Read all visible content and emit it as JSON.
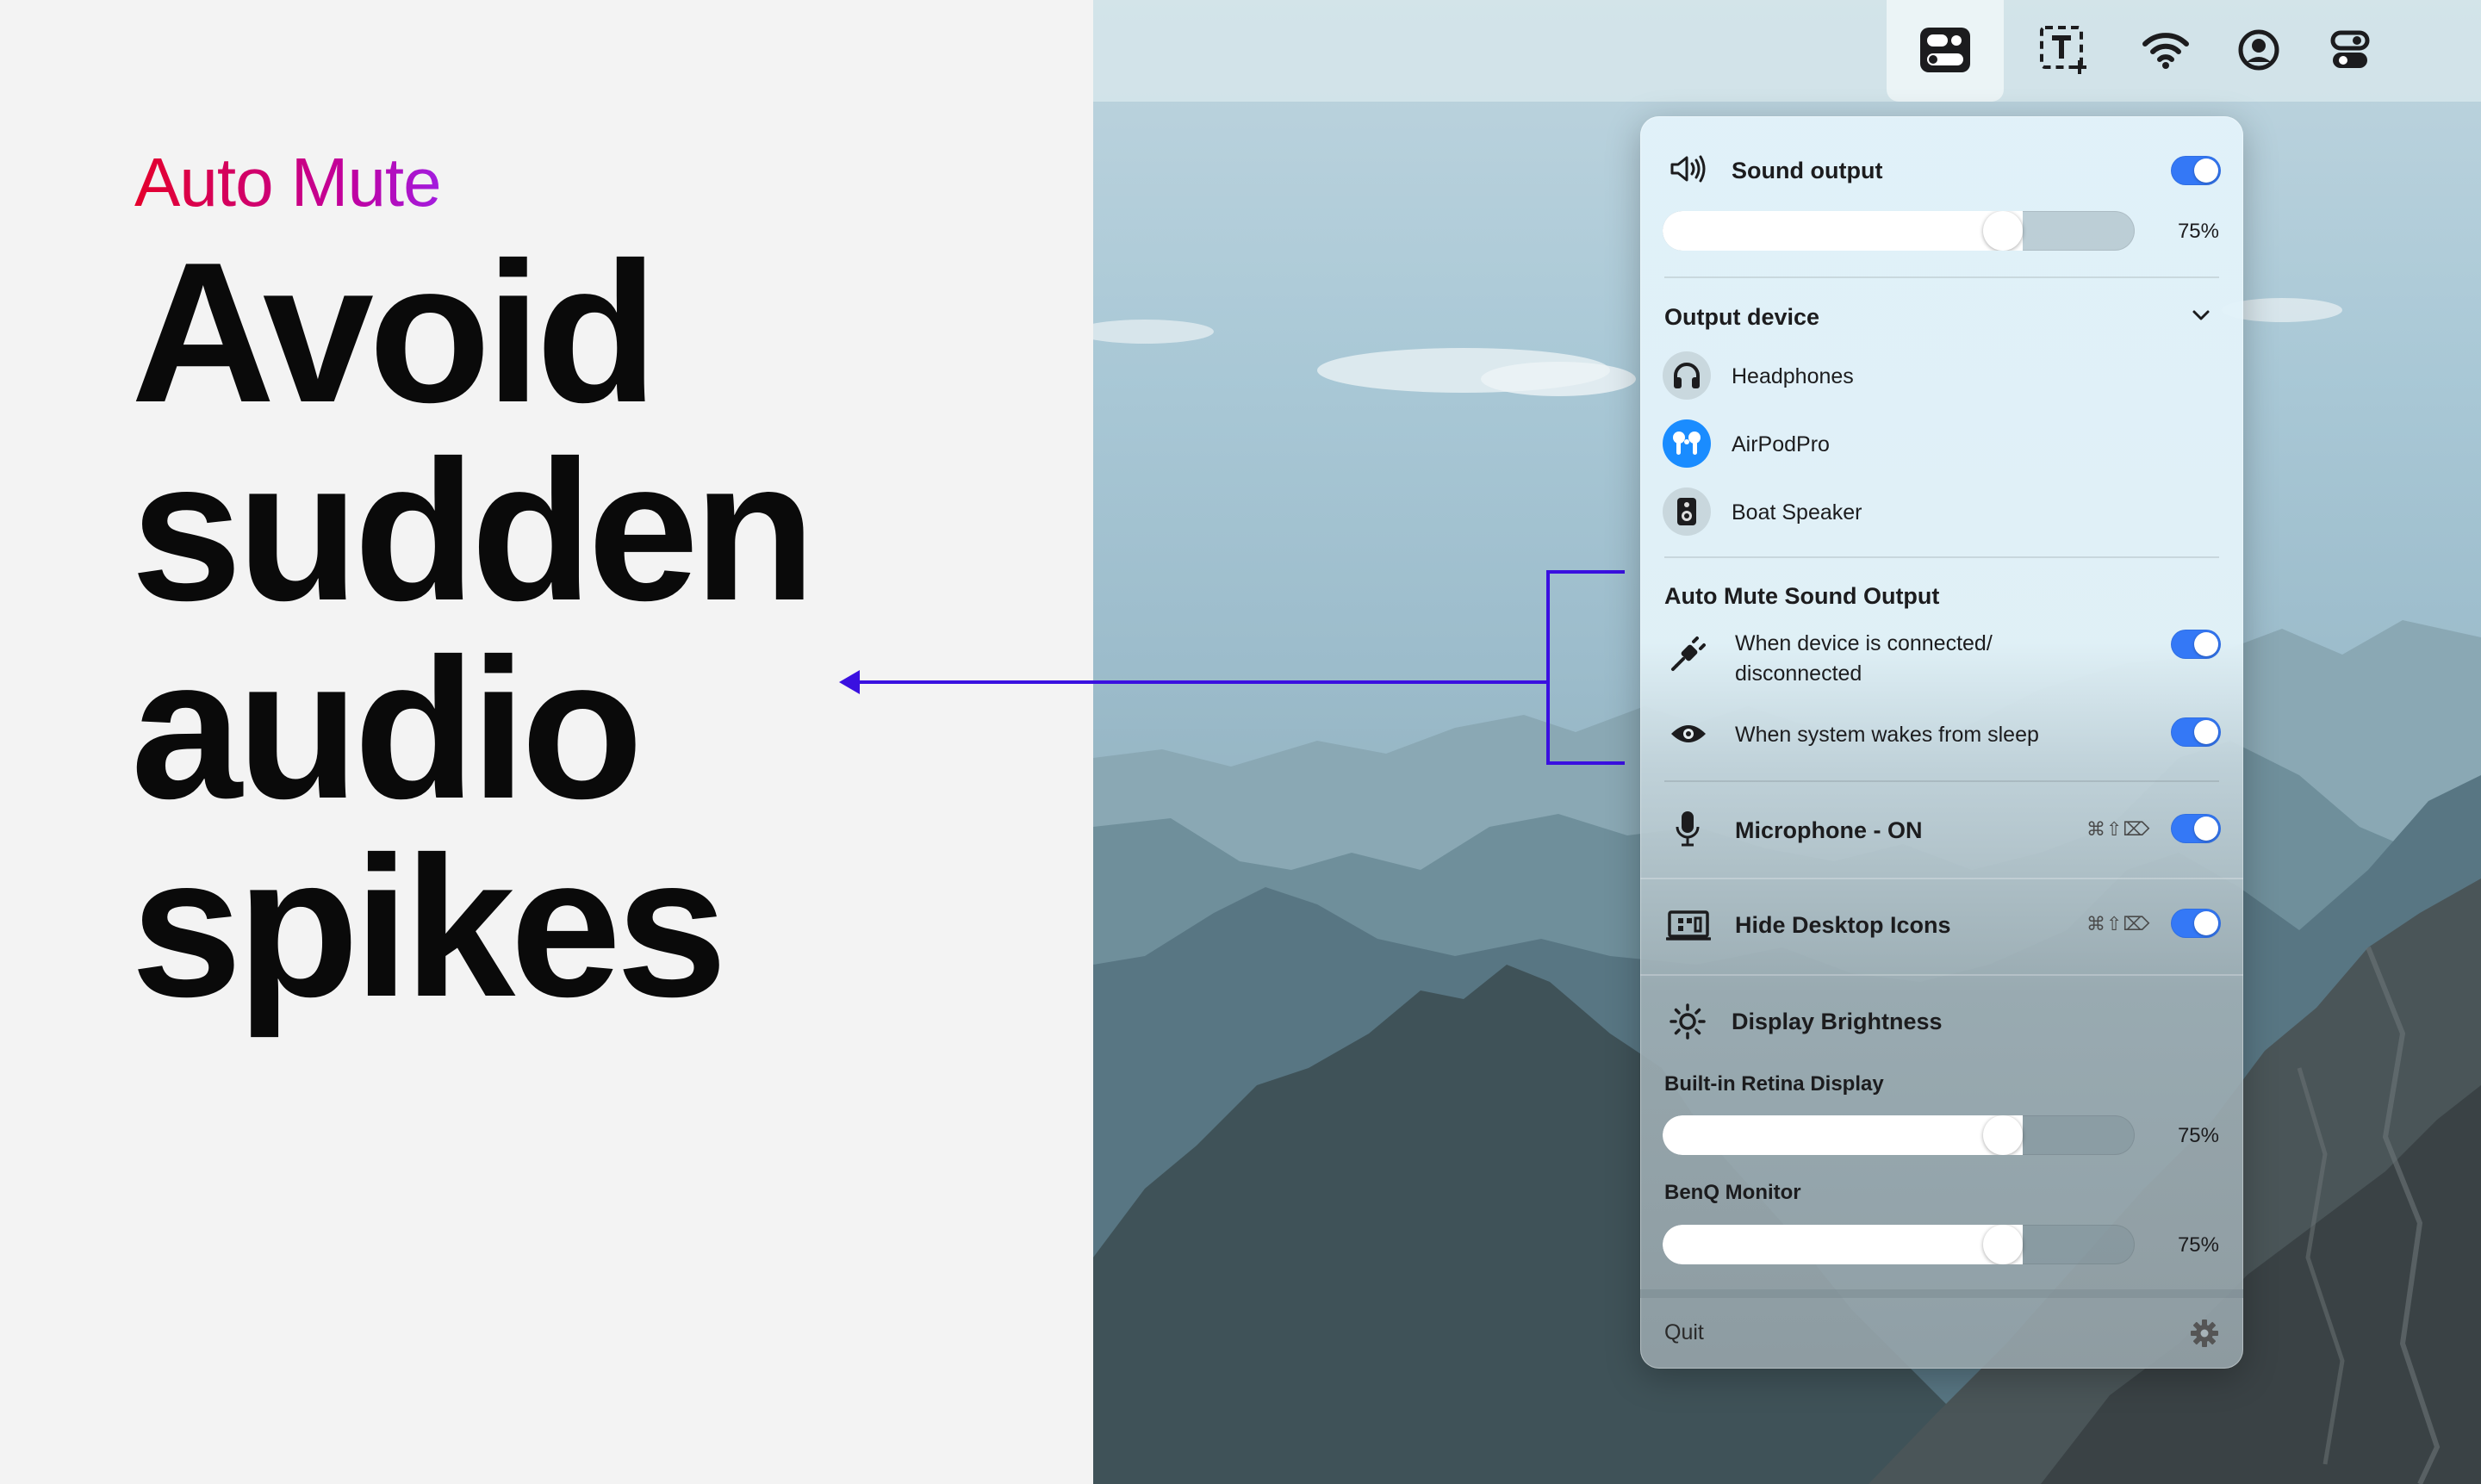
{
  "marketing": {
    "eyebrow": "Auto Mute",
    "headline_lines": [
      "Avoid",
      "sudden",
      "audio",
      "spikes"
    ]
  },
  "menubar": {
    "icons": [
      "toggles-app-icon",
      "text-capture-icon",
      "wifi-icon",
      "account-icon",
      "switches-icon"
    ]
  },
  "panel": {
    "sound_output": {
      "title": "Sound output",
      "enabled": true,
      "volume_percent": 75,
      "volume_label": "75%"
    },
    "output_device": {
      "title": "Output device",
      "devices": [
        {
          "name": "Headphones",
          "icon": "headphones-icon",
          "selected": false
        },
        {
          "name": "AirPodPro",
          "icon": "airpods-icon",
          "selected": true
        },
        {
          "name": "Boat Speaker",
          "icon": "speaker-icon",
          "selected": false
        }
      ]
    },
    "auto_mute": {
      "title": "Auto Mute Sound Output",
      "options": [
        {
          "line1": "When device is connected/",
          "line2": "disconnected",
          "icon": "plug-icon",
          "enabled": true
        },
        {
          "line1": "When system wakes from sleep",
          "line2": "",
          "icon": "eye-icon",
          "enabled": true
        }
      ]
    },
    "microphone": {
      "title": "Microphone - ON",
      "shortcut": "⌘⇧⌦",
      "enabled": true
    },
    "hide_desktop": {
      "title": "Hide Desktop Icons",
      "shortcut": "⌘⇧⌦",
      "enabled": true
    },
    "brightness": {
      "title": "Display Brightness",
      "displays": [
        {
          "name": "Built-in Retina Display",
          "percent": 75,
          "label": "75%"
        },
        {
          "name": "BenQ Monitor",
          "percent": 75,
          "label": "75%"
        }
      ]
    },
    "footer": {
      "quit_label": "Quit"
    }
  },
  "colors": {
    "accent": "#3478f6",
    "annotation": "#3a10e0",
    "airpods_badge": "#1a8cff"
  }
}
